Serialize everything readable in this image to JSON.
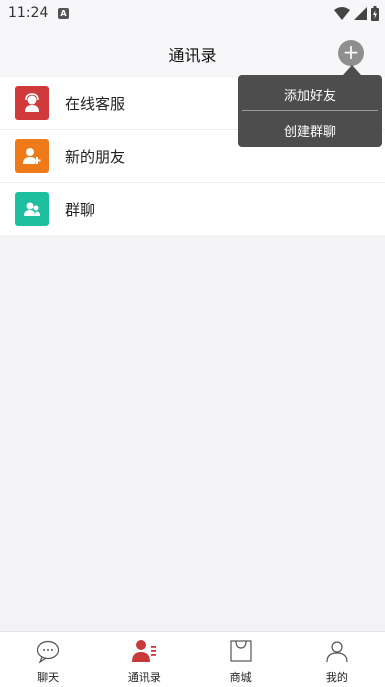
{
  "status_bar": {
    "time": "11:24",
    "notification_letter": "A"
  },
  "header": {
    "title": "通讯录",
    "add_symbol": "+"
  },
  "contacts_menu": [
    {
      "label": "在线客服",
      "icon": "customer-service-icon",
      "color": "#d03a3a"
    },
    {
      "label": "新的朋友",
      "icon": "add-friend-icon",
      "color": "#ef7a1a"
    },
    {
      "label": "群聊",
      "icon": "group-icon",
      "color": "#1dbfa0"
    }
  ],
  "popup_menu": {
    "add_friend": "添加好友",
    "create_group": "创建群聊"
  },
  "tabbar": [
    {
      "label": "聊天",
      "icon": "chat-icon"
    },
    {
      "label": "通讯录",
      "icon": "contacts-icon",
      "active_color": "#c83a3a"
    },
    {
      "label": "商城",
      "icon": "shop-icon"
    },
    {
      "label": "我的",
      "icon": "profile-icon"
    }
  ]
}
